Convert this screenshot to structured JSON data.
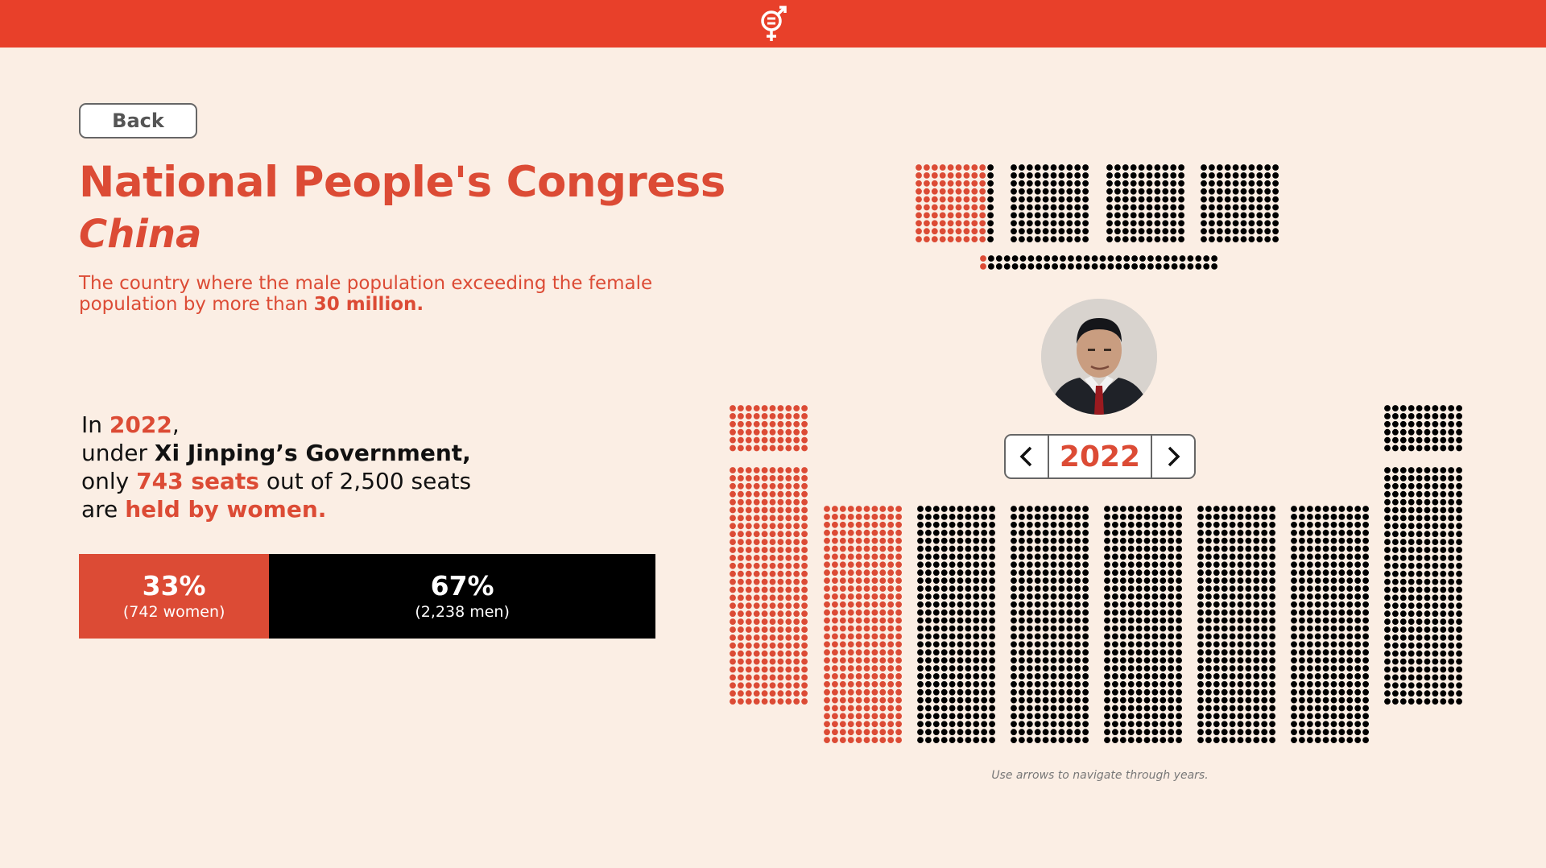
{
  "header": {
    "logo_icon": "gender-equality-icon"
  },
  "nav": {
    "back_label": "Back"
  },
  "title": "National People's Congress",
  "country": "China",
  "subtitle": {
    "text": "The country where the male population exceeding the female population by more than ",
    "highlight": "30 million."
  },
  "stat": {
    "line1_prefix": "In ",
    "year": "2022",
    "line1_suffix": ",",
    "line2_prefix": "under ",
    "government": "Xi Jinping’s Government,",
    "line3_prefix": "only ",
    "women_seats": "743 seats",
    "line3_suffix": " out of 2,500 seats",
    "line4_prefix": "are ",
    "line4_highlight": "held by women."
  },
  "share_bar": {
    "women_fraction": 0.33,
    "women_pct": "33%",
    "women_label": "(742 women)",
    "men_pct": "67%",
    "men_label": "(2,238 men)"
  },
  "seat_chart": {
    "year": "2022",
    "women_color": "#dc4b35",
    "men_color": "#000000",
    "prev_icon": "chevron-left-icon",
    "next_icon": "chevron-right-icon",
    "leader_photo": "leader-portrait",
    "hint": "Use arrows to navigate through years."
  },
  "colors": {
    "accent": "#e8402a",
    "text_red": "#dc4b35",
    "background": "#fbeee4"
  }
}
